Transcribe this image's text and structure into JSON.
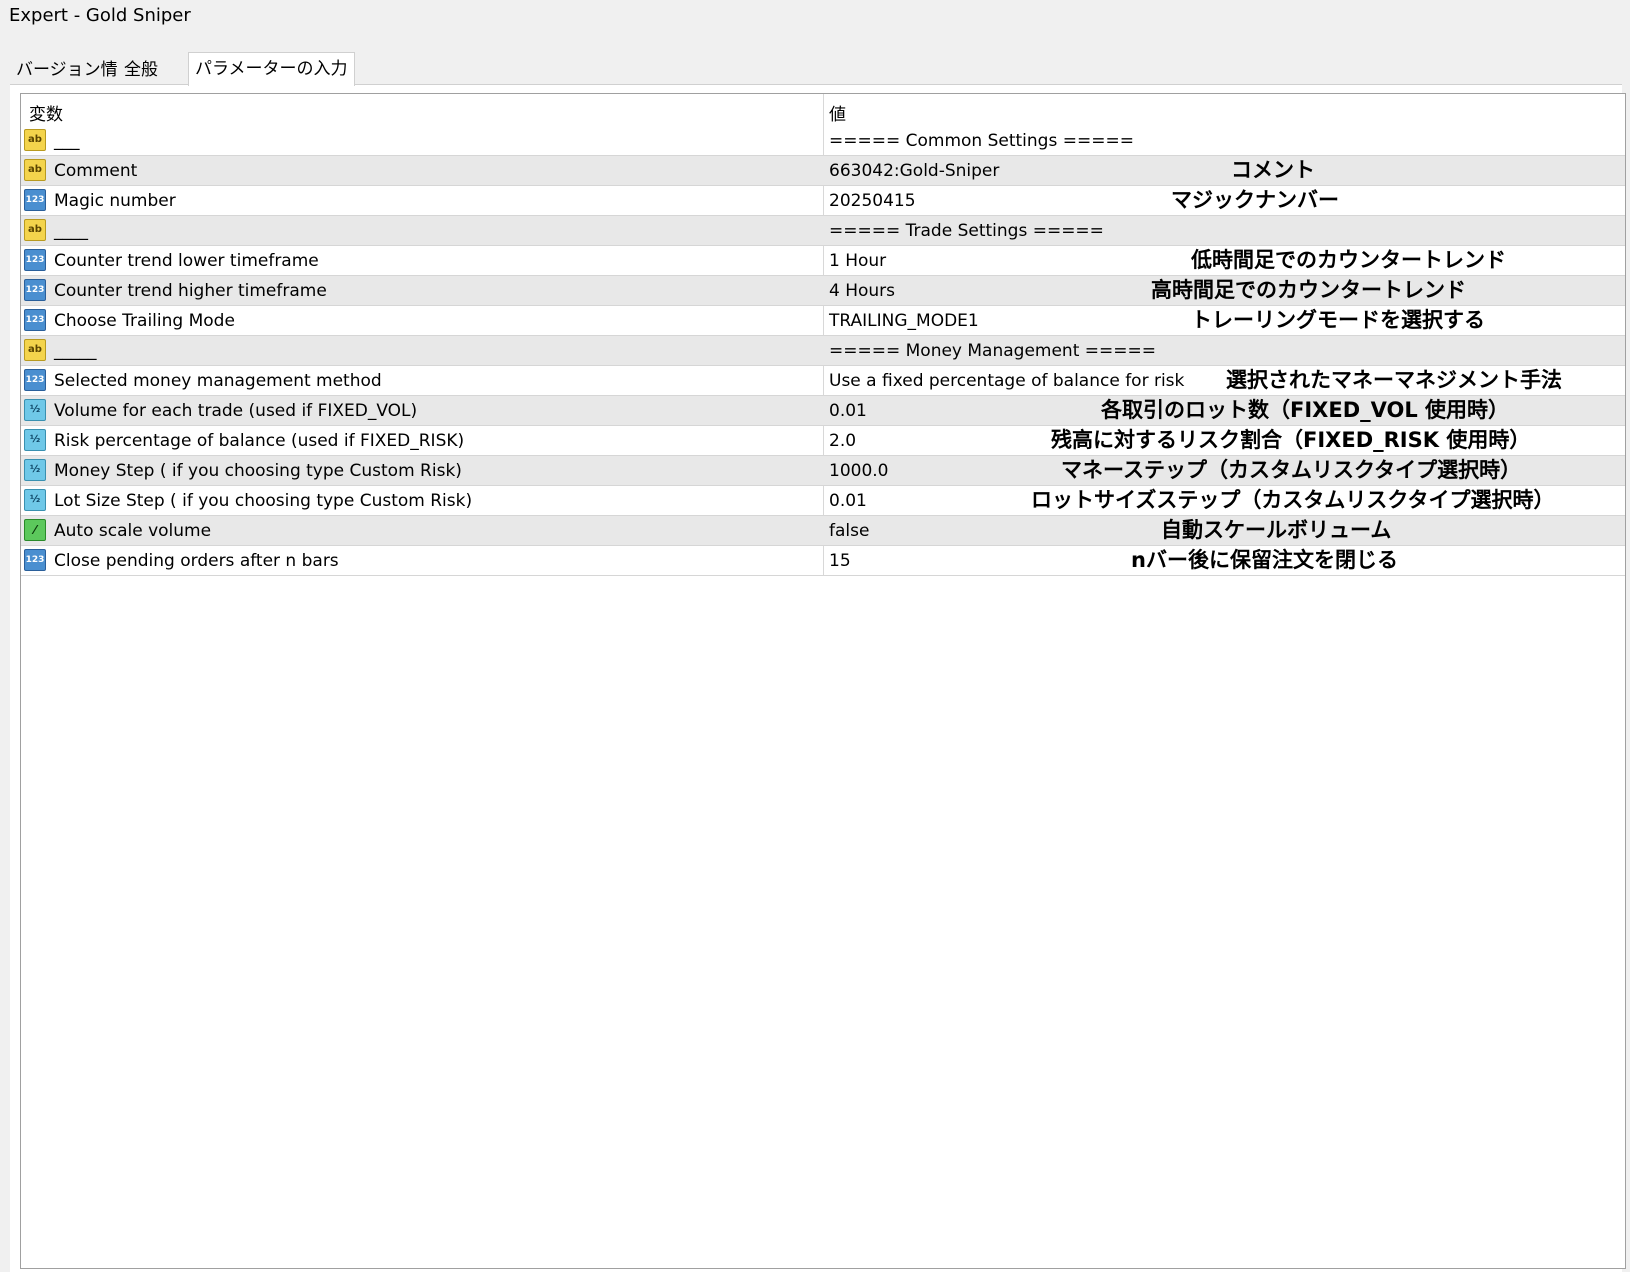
{
  "window": {
    "title": "Expert - Gold Sniper"
  },
  "tabs": [
    {
      "label": "バージョン情報"
    },
    {
      "label": "全般"
    },
    {
      "label": "パラメーターの入力"
    }
  ],
  "grid": {
    "header": {
      "variable": "変数",
      "value": "値"
    },
    "rows": [
      {
        "icon": "string-icon",
        "name": "___",
        "value": "===== Common Settings =====",
        "note": ""
      },
      {
        "icon": "string-icon",
        "name": "Comment",
        "value": "663042:Gold-Sniper",
        "note": "コメント"
      },
      {
        "icon": "integer-icon",
        "name": "Magic number",
        "value": "20250415",
        "note": "マジックナンバー"
      },
      {
        "icon": "string-icon",
        "name": "____",
        "value": "===== Trade Settings =====",
        "note": ""
      },
      {
        "icon": "integer-icon",
        "name": "Counter trend lower timeframe",
        "value": "1 Hour",
        "note": "低時間足でのカウンタートレンド"
      },
      {
        "icon": "integer-icon",
        "name": "Counter trend higher timeframe",
        "value": "4 Hours",
        "note": "高時間足でのカウンタートレンド"
      },
      {
        "icon": "integer-icon",
        "name": "Choose Trailing Mode",
        "value": "TRAILING_MODE1",
        "note": "トレーリングモードを選択する"
      },
      {
        "icon": "string-icon",
        "name": "_____",
        "value": "===== Money Management =====",
        "note": ""
      },
      {
        "icon": "integer-icon",
        "name": "Selected money management method",
        "value": "Use a fixed percentage of balance for risk",
        "note": "選択されたマネーマネジメント手法"
      },
      {
        "icon": "double-icon",
        "name": "Volume for each trade (used if FIXED_VOL)",
        "value": "0.01",
        "note": "各取引のロット数（FIXED_VOL 使用時）"
      },
      {
        "icon": "double-icon",
        "name": "Risk percentage of balance (used if FIXED_RISK)",
        "value": "2.0",
        "note": "残高に対するリスク割合（FIXED_RISK 使用時）"
      },
      {
        "icon": "double-icon",
        "name": "Money Step ( if you choosing type Custom Risk)",
        "value": "1000.0",
        "note": "マネーステップ（カスタムリスクタイプ選択時）"
      },
      {
        "icon": "double-icon",
        "name": "Lot Size Step ( if you choosing type Custom Risk)",
        "value": "0.01",
        "note": "ロットサイズステップ（カスタムリスクタイプ選択時）"
      },
      {
        "icon": "bool-icon",
        "name": "Auto scale volume",
        "value": "false",
        "note": "自動スケールボリューム"
      },
      {
        "icon": "integer-icon",
        "name": "Close pending orders after n bars",
        "value": "15",
        "note": "nバー後に保留注文を閉じる"
      }
    ]
  }
}
